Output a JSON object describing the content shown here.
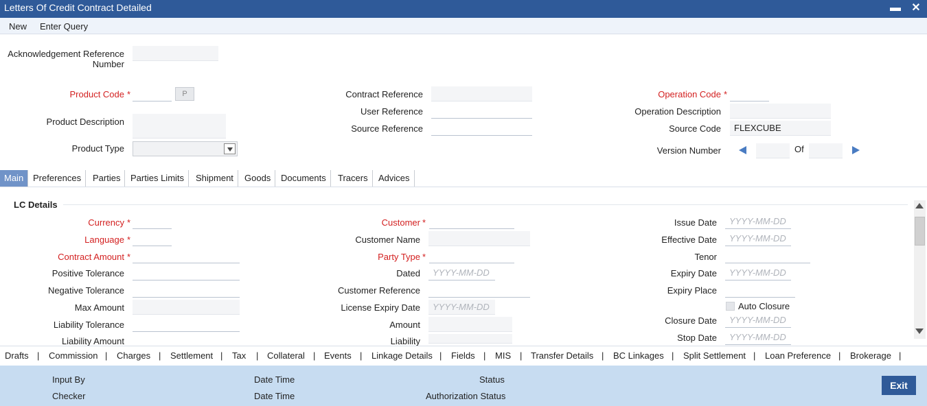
{
  "window": {
    "title": "Letters Of Credit Contract Detailed",
    "minimize": "▬",
    "close": "✕"
  },
  "menu": {
    "new": "New",
    "enter_query": "Enter Query"
  },
  "header": {
    "ack_ref_label_line1": "Acknowledgement Reference",
    "ack_ref_label_line2": "Number",
    "product_code_label": "Product Code",
    "product_code_button": "P",
    "product_description_label": "Product Description",
    "product_type_label": "Product Type",
    "contract_reference_label": "Contract Reference",
    "user_reference_label": "User Reference",
    "source_reference_label": "Source Reference",
    "operation_code_label": "Operation Code",
    "operation_description_label": "Operation Description",
    "source_code_label": "Source Code",
    "source_code_value": "FLEXCUBE",
    "version_number_label": "Version Number",
    "of_label": "Of"
  },
  "required_marker": "*",
  "tabs": [
    "Main",
    "Preferences",
    "Parties",
    "Parties Limits",
    "Shipment",
    "Goods",
    "Documents",
    "Tracers",
    "Advices"
  ],
  "lc_details": {
    "title": "LC Details",
    "date_placeholder": "YYYY-MM-DD",
    "col1": {
      "currency": "Currency",
      "language": "Language",
      "contract_amount": "Contract Amount",
      "positive_tolerance": "Positive Tolerance",
      "negative_tolerance": "Negative Tolerance",
      "max_amount": "Max Amount",
      "liability_tolerance": "Liability Tolerance",
      "liability_amount": "Liability Amount"
    },
    "col2": {
      "customer": "Customer",
      "customer_name": "Customer Name",
      "party_type": "Party Type",
      "dated": "Dated",
      "customer_reference": "Customer Reference",
      "license_expiry_date": "License Expiry Date",
      "amount": "Amount",
      "liability": "Liability"
    },
    "col3": {
      "issue_date": "Issue Date",
      "effective_date": "Effective Date",
      "tenor": "Tenor",
      "expiry_date": "Expiry Date",
      "expiry_place": "Expiry Place",
      "auto_closure": "Auto Closure",
      "closure_date": "Closure Date",
      "stop_date": "Stop Date"
    }
  },
  "bottom_links": [
    "Drafts",
    "Commission",
    "Charges",
    "Settlement",
    "Tax",
    "Collateral",
    "Events",
    "Linkage Details",
    "Fields",
    "MIS",
    "Transfer Details",
    "BC Linkages",
    "Split Settlement",
    "Loan Preference",
    "Brokerage"
  ],
  "bottom_separator": "|",
  "footer": {
    "input_by": "Input By",
    "checker": "Checker",
    "date_time_1": "Date Time",
    "date_time_2": "Date Time",
    "status": "Status",
    "authorization_status": "Authorization Status",
    "exit": "Exit"
  }
}
